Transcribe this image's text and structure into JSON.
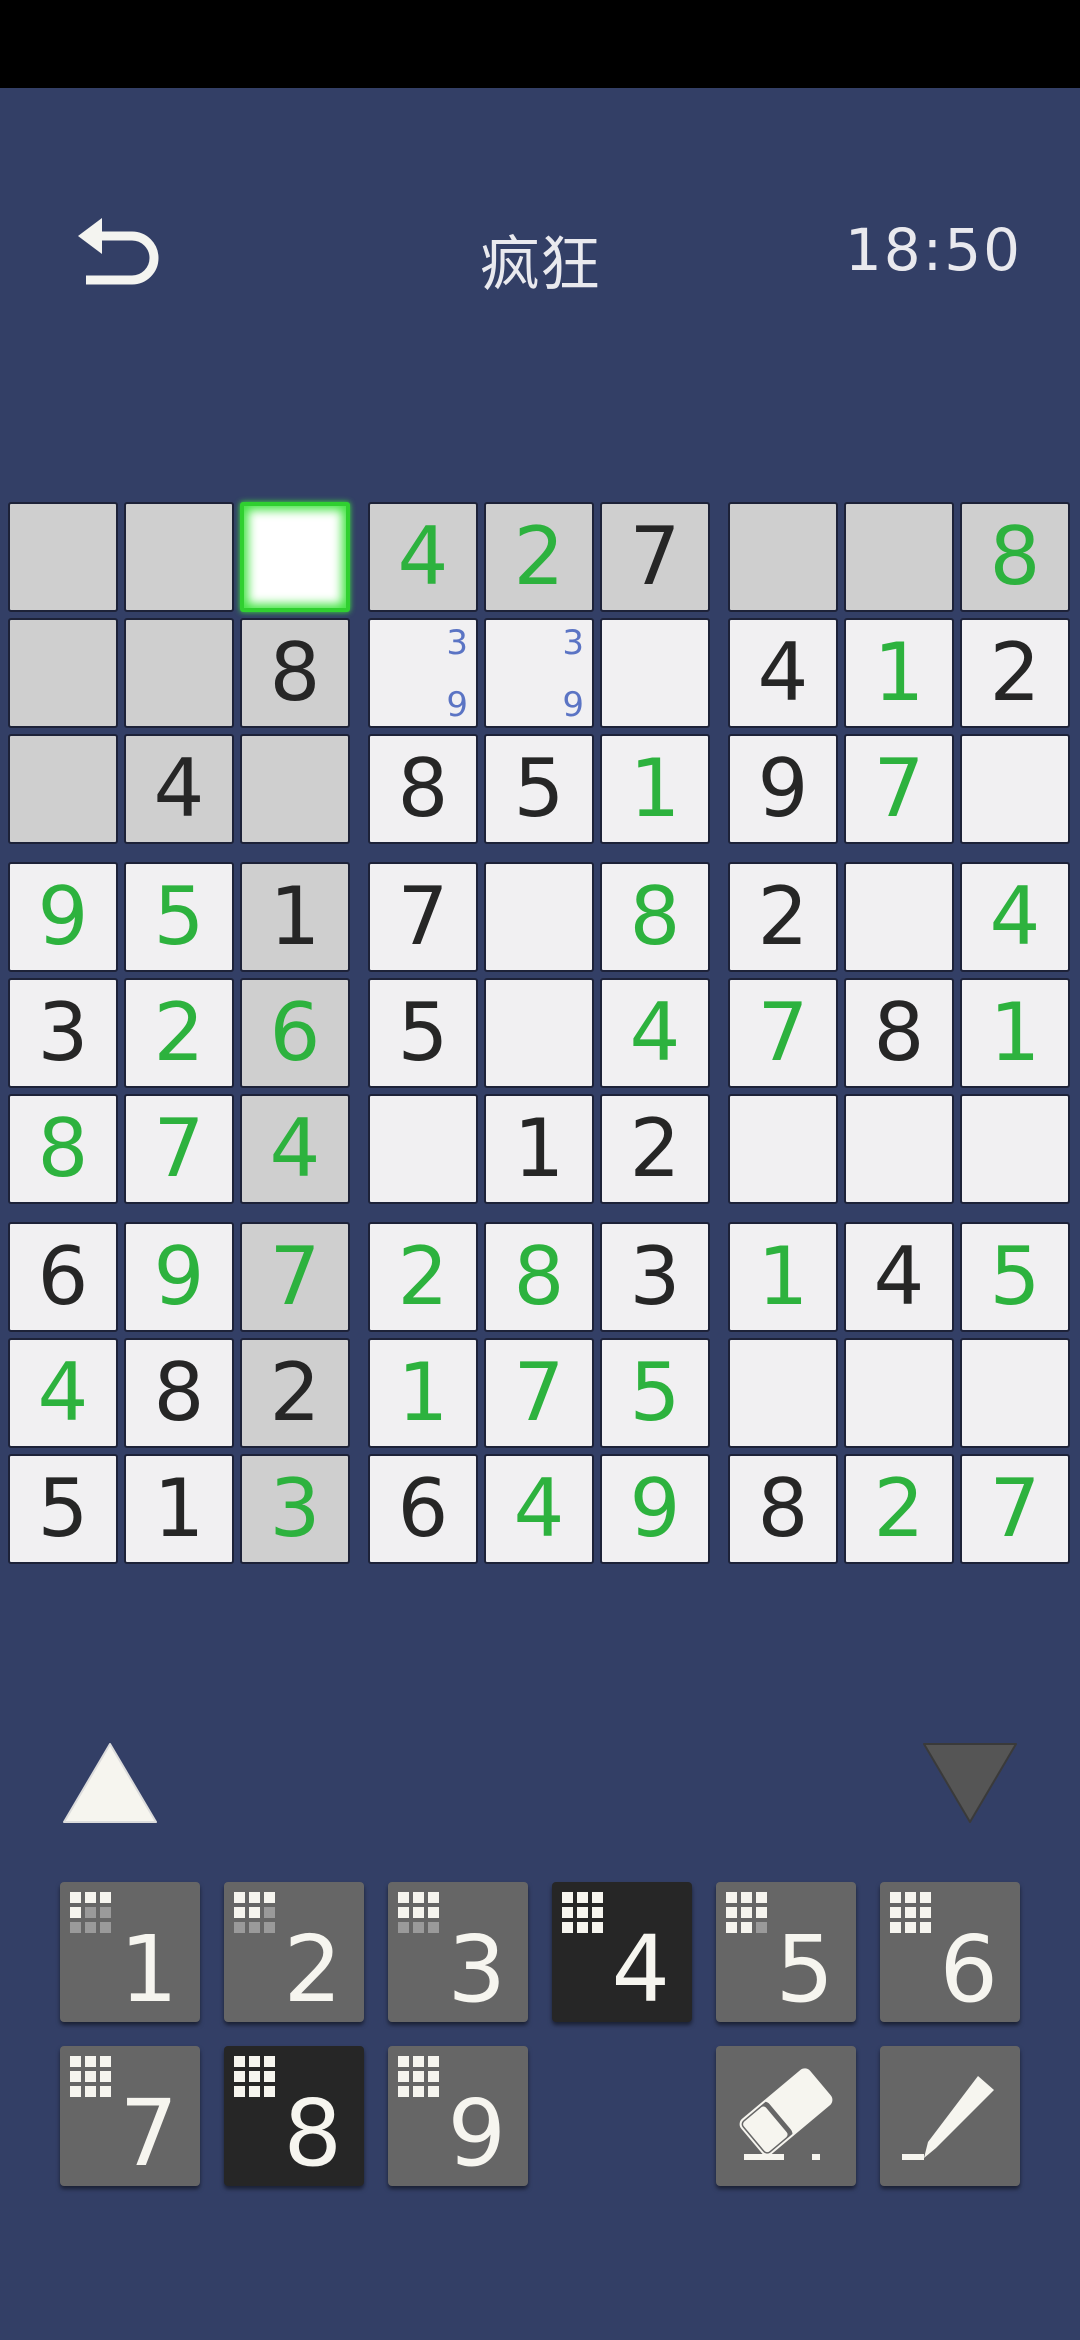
{
  "header": {
    "title": "疯狂",
    "timer": "18:50"
  },
  "board": {
    "cells": [
      [
        "",
        "",
        "",
        "4",
        "2",
        "7",
        "",
        "",
        "8"
      ],
      [
        "",
        "",
        "8",
        "",
        "",
        "",
        "4",
        "1",
        "2"
      ],
      [
        "",
        "4",
        "",
        "8",
        "5",
        "1",
        "9",
        "7",
        ""
      ],
      [
        "9",
        "5",
        "1",
        "7",
        "",
        "8",
        "2",
        "",
        "4"
      ],
      [
        "3",
        "2",
        "6",
        "5",
        "",
        "4",
        "7",
        "8",
        "1"
      ],
      [
        "8",
        "7",
        "4",
        "",
        "1",
        "2",
        "",
        "",
        ""
      ],
      [
        "6",
        "9",
        "7",
        "2",
        "8",
        "3",
        "1",
        "4",
        "5"
      ],
      [
        "4",
        "8",
        "2",
        "1",
        "7",
        "5",
        "",
        "",
        ""
      ],
      [
        "5",
        "1",
        "3",
        "6",
        "4",
        "9",
        "8",
        "2",
        "7"
      ]
    ],
    "user": [
      [
        0,
        0,
        0,
        1,
        1,
        0,
        0,
        0,
        1
      ],
      [
        0,
        0,
        0,
        0,
        0,
        0,
        0,
        1,
        0
      ],
      [
        0,
        0,
        0,
        0,
        0,
        1,
        0,
        1,
        0
      ],
      [
        1,
        1,
        0,
        0,
        0,
        1,
        0,
        0,
        1
      ],
      [
        0,
        1,
        1,
        0,
        0,
        1,
        1,
        0,
        1
      ],
      [
        1,
        1,
        1,
        0,
        0,
        0,
        0,
        0,
        0
      ],
      [
        0,
        1,
        1,
        1,
        1,
        0,
        1,
        0,
        1
      ],
      [
        1,
        0,
        0,
        1,
        1,
        1,
        0,
        0,
        0
      ],
      [
        0,
        0,
        1,
        0,
        1,
        1,
        0,
        1,
        1
      ]
    ],
    "notes": [
      {
        "row": 1,
        "col": 3,
        "values": [
          "3",
          "9"
        ]
      },
      {
        "row": 1,
        "col": 4,
        "values": [
          "3",
          "9"
        ]
      }
    ],
    "selected": [
      0,
      2
    ]
  },
  "numpad": {
    "numbers": [
      "1",
      "2",
      "3",
      "4",
      "5",
      "6",
      "7",
      "8",
      "9"
    ],
    "dark": [
      "4",
      "8"
    ]
  },
  "icons": {
    "back": "undo-arrow-icon",
    "up": "triangle-up-icon",
    "down": "triangle-down-icon",
    "erase": "eraser-icon",
    "pencil": "pencil-icon"
  },
  "colors": {
    "background": "#333f66",
    "given": "#262626",
    "user": "#2db23e",
    "note": "#5b74c4",
    "selected_glow": "#41e441"
  }
}
